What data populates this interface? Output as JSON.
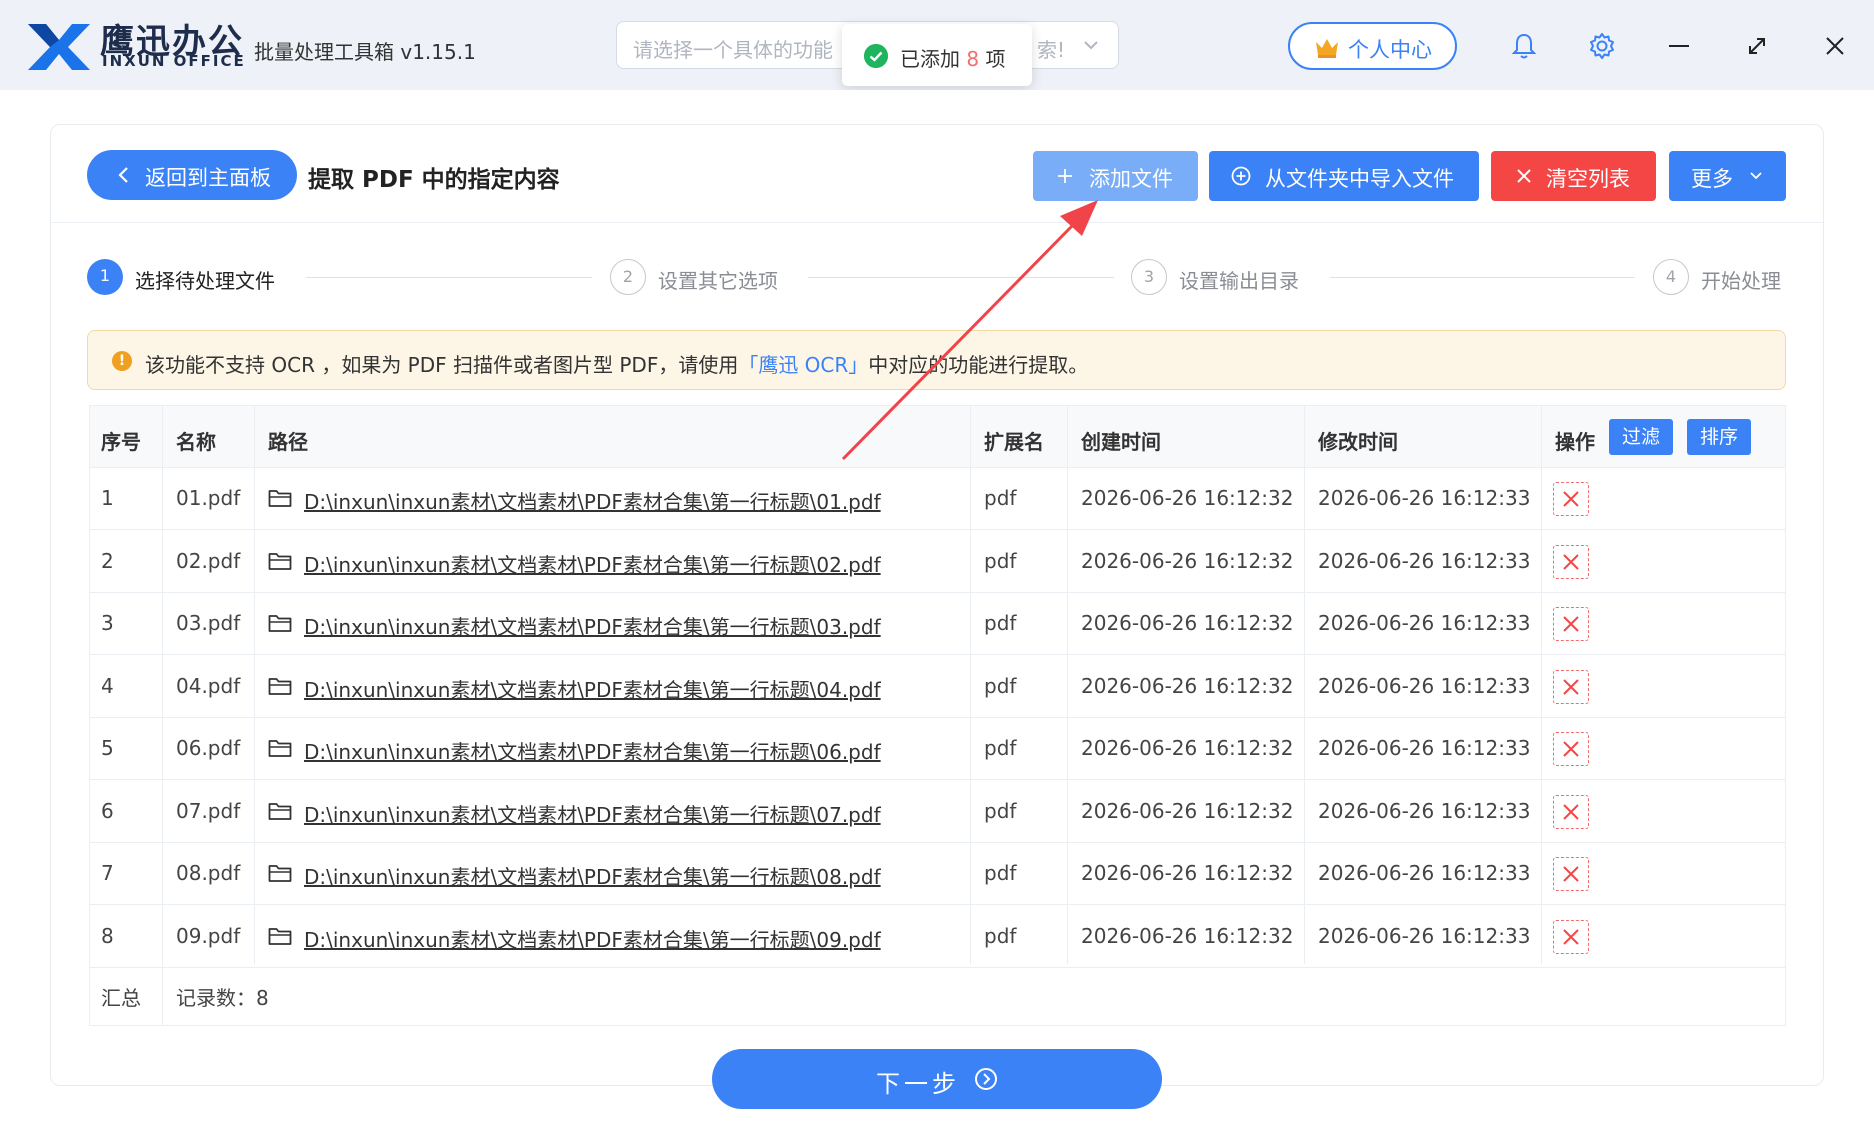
{
  "app": {
    "brand_cn": "鹰迅办公",
    "brand_en": "INXUN OFFICE",
    "title": "批量处理工具箱 v1.15.1"
  },
  "search": {
    "placeholder_left": "请选择一个具体的功能",
    "placeholder_right": "索!"
  },
  "toast": {
    "prefix": "已添加",
    "count": "8",
    "suffix": "项"
  },
  "titlebar": {
    "user_center": "个人中心",
    "icons": [
      "bell-icon",
      "gear-icon",
      "minimize-icon",
      "maximize-icon",
      "close-icon"
    ]
  },
  "header": {
    "back_label": "返回到主面板",
    "page_title": "提取 PDF 中的指定内容",
    "add_file": "添加文件",
    "import_folder": "从文件夹中导入文件",
    "clear_list": "清空列表",
    "more": "更多"
  },
  "steps": [
    {
      "num": "1",
      "label": "选择待处理文件",
      "active": true
    },
    {
      "num": "2",
      "label": "设置其它选项",
      "active": false
    },
    {
      "num": "3",
      "label": "设置输出目录",
      "active": false
    },
    {
      "num": "4",
      "label": "开始处理",
      "active": false
    }
  ],
  "notice": {
    "before": "该功能不支持 OCR ，如果为 PDF 扫描件或者图片型 PDF，请使用",
    "link": "「鹰迅 OCR」",
    "after": "中对应的功能进行提取。"
  },
  "table": {
    "columns": {
      "index": "序号",
      "name": "名称",
      "path": "路径",
      "ext": "扩展名",
      "created": "创建时间",
      "modified": "修改时间",
      "action": "操作",
      "filter": "过滤",
      "sort": "排序"
    },
    "rows": [
      {
        "index": "1",
        "name": "01.pdf",
        "path": "D:\\inxun\\inxun素材\\文档素材\\PDF素材合集\\第一行标题\\01.pdf",
        "ext": "pdf",
        "created": "2026-06-26 16:12:32",
        "modified": "2026-06-26 16:12:33"
      },
      {
        "index": "2",
        "name": "02.pdf",
        "path": "D:\\inxun\\inxun素材\\文档素材\\PDF素材合集\\第一行标题\\02.pdf",
        "ext": "pdf",
        "created": "2026-06-26 16:12:32",
        "modified": "2026-06-26 16:12:33"
      },
      {
        "index": "3",
        "name": "03.pdf",
        "path": "D:\\inxun\\inxun素材\\文档素材\\PDF素材合集\\第一行标题\\03.pdf",
        "ext": "pdf",
        "created": "2026-06-26 16:12:32",
        "modified": "2026-06-26 16:12:33"
      },
      {
        "index": "4",
        "name": "04.pdf",
        "path": "D:\\inxun\\inxun素材\\文档素材\\PDF素材合集\\第一行标题\\04.pdf",
        "ext": "pdf",
        "created": "2026-06-26 16:12:32",
        "modified": "2026-06-26 16:12:33"
      },
      {
        "index": "5",
        "name": "06.pdf",
        "path": "D:\\inxun\\inxun素材\\文档素材\\PDF素材合集\\第一行标题\\06.pdf",
        "ext": "pdf",
        "created": "2026-06-26 16:12:32",
        "modified": "2026-06-26 16:12:33"
      },
      {
        "index": "6",
        "name": "07.pdf",
        "path": "D:\\inxun\\inxun素材\\文档素材\\PDF素材合集\\第一行标题\\07.pdf",
        "ext": "pdf",
        "created": "2026-06-26 16:12:32",
        "modified": "2026-06-26 16:12:33"
      },
      {
        "index": "7",
        "name": "08.pdf",
        "path": "D:\\inxun\\inxun素材\\文档素材\\PDF素材合集\\第一行标题\\08.pdf",
        "ext": "pdf",
        "created": "2026-06-26 16:12:32",
        "modified": "2026-06-26 16:12:33"
      },
      {
        "index": "8",
        "name": "09.pdf",
        "path": "D:\\inxun\\inxun素材\\文档素材\\PDF素材合集\\第一行标题\\09.pdf",
        "ext": "pdf",
        "created": "2026-06-26 16:12:32",
        "modified": "2026-06-26 16:12:33"
      }
    ],
    "summary": {
      "label": "汇总",
      "records": "记录数：8"
    }
  },
  "footer": {
    "next": "下一步"
  },
  "colors": {
    "primary": "#3b82f6",
    "primary_light": "#79adf8",
    "danger": "#f54646",
    "success": "#1fb55e",
    "warning": "#f0a020",
    "annotation_arrow": "#f0444a"
  }
}
